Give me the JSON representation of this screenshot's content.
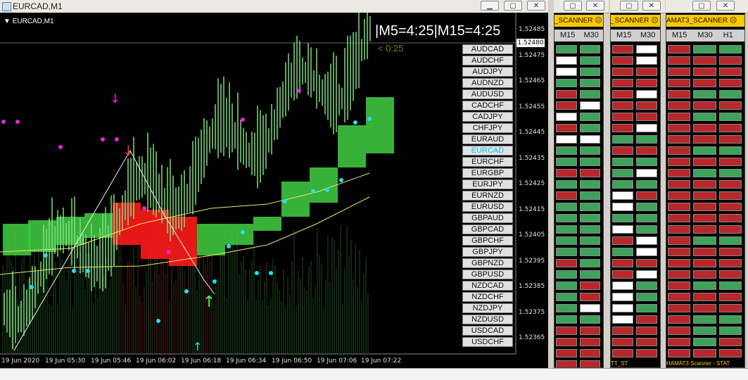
{
  "window": {
    "title": "EURCAD,M1",
    "min_label": "▁",
    "max_label": "▢",
    "close_label": "✕"
  },
  "chart": {
    "symbol_label": "▼ EURCAD,M1",
    "timer_text": "|M5=4:25|M15=4:25",
    "countdown": "< 0:25",
    "current_price": "1.52480",
    "y_ticks": [
      "1.52485",
      "1.52475",
      "1.52465",
      "1.52455",
      "1.52445",
      "1.52435",
      "1.52425",
      "1.52415",
      "1.52405",
      "1.52395",
      "1.52385",
      "1.52375",
      "1.52365"
    ],
    "x_ticks": [
      "19 Jun 2020",
      "19 Jun 05:30",
      "19 Jun 05:46",
      "19 Jun 06:02",
      "19 Jun 06:18",
      "19 Jun 06:34",
      "19 Jun 06:50",
      "19 Jun 07:06",
      "19 Jun 07:22"
    ],
    "symbols": [
      "AUDCAD",
      "AUDCHF",
      "AUDJPY",
      "AUDNZD",
      "AUDUSD",
      "CADCHF",
      "CADJPY",
      "CHFJPY",
      "EURAUD",
      "EURCAD",
      "EURCHF",
      "EURGBP",
      "EURJPY",
      "EURNZD",
      "EURUSD",
      "GBPAUD",
      "GBPCAD",
      "GBPCHF",
      "GBPJPY",
      "GBPNZD",
      "GBPUSD",
      "NZDCAD",
      "NZDCHF",
      "NZDJPY",
      "NZDUSD",
      "USDCAD",
      "USDCHF"
    ],
    "active_symbol": "EURCAD",
    "colors": {
      "bull": "#3ec43e",
      "bear": "#ff1a1a",
      "dot_cyan": "#22e0f0",
      "dot_magenta": "#ee22dd"
    }
  },
  "scanners": [
    {
      "title": "_SCANNER ☹",
      "cols": [
        "M15",
        "M30"
      ],
      "rows": [
        "gg",
        "wg",
        "wg",
        "gg",
        "rg",
        "rw",
        "wg",
        "rg",
        "ww",
        "gg",
        "gg",
        "rr",
        "gg",
        "rg",
        "gg",
        "gg",
        "gg",
        "gg",
        "gg",
        "rg",
        "gg",
        "gr",
        "gr",
        "gw",
        "gg",
        "rr",
        "rr",
        "rr",
        "rr",
        "rr"
      ]
    },
    {
      "title": "_SCANNER ☹",
      "cols": [
        "M15",
        "M30"
      ],
      "footer": "TT_ST",
      "rows": [
        "rw",
        "rw",
        "rr",
        "rr",
        "rw",
        "rr",
        "rr",
        "rw",
        "gg",
        "rr",
        "gg",
        "gw",
        "gg",
        "wr",
        "wg",
        "gg",
        "wg",
        "rw",
        "gw",
        "rr",
        "rw",
        "wg",
        "wg",
        "wg",
        "wr",
        "rr",
        "rr",
        "rr",
        "rr",
        "rr"
      ]
    },
    {
      "title": "AMAT3_SCANNER ☹",
      "cols": [
        "M15",
        "M30",
        "H1"
      ],
      "footer": "HAMAT3 Scanner - STAT",
      "rows": [
        "rgg",
        "rrr",
        "rrr",
        "rrr",
        "rgg",
        "rrr",
        "rgg",
        "rrr",
        "rrr",
        "rgg",
        "rrr",
        "rgg",
        "rrr",
        "rrr",
        "rrr",
        "rrr",
        "rrr",
        "rgg",
        "rrr",
        "rrr",
        "rrr",
        "rgg",
        "rrr",
        "rrr",
        "rgg",
        "rgg",
        "rgr",
        "rrr",
        "rrr",
        "rrr"
      ]
    }
  ]
}
